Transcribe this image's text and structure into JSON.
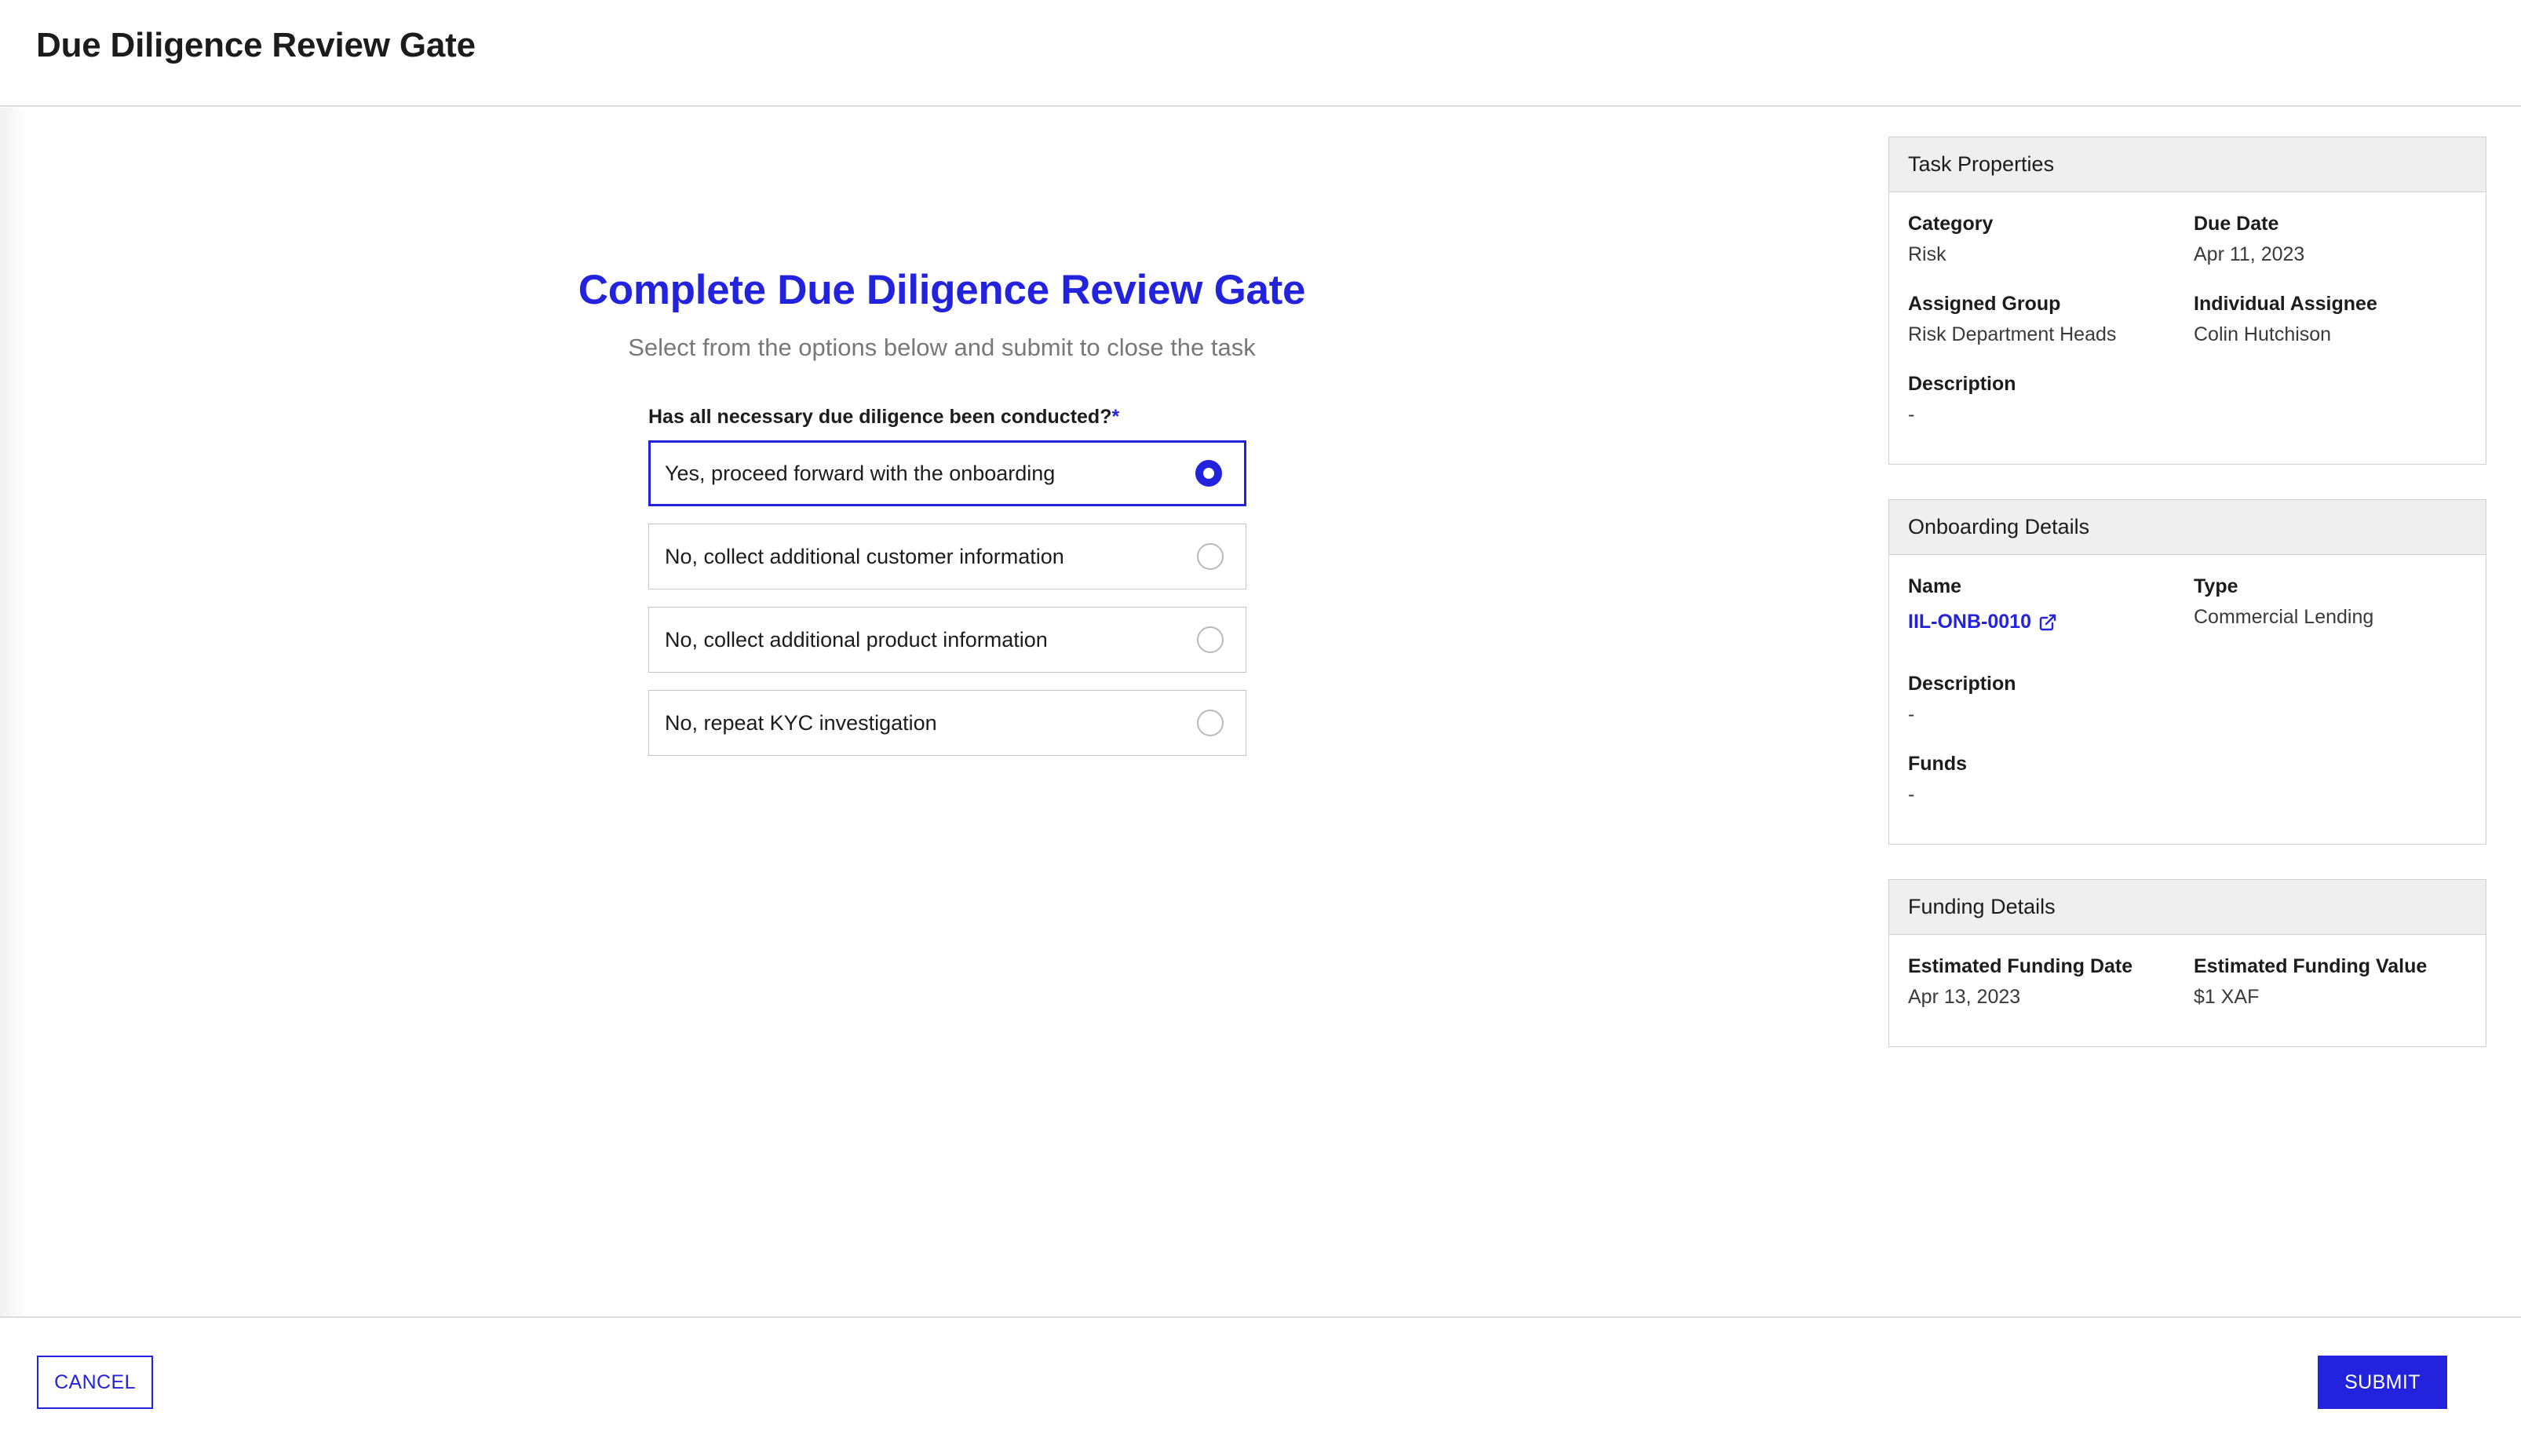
{
  "header": {
    "title": "Due Diligence Review Gate"
  },
  "form": {
    "title": "Complete Due Diligence Review Gate",
    "subtitle": "Select from the options below and submit to close the task",
    "question": {
      "label": "Has all necessary due diligence been conducted?",
      "required_marker": "*",
      "options": [
        {
          "label": "Yes, proceed forward with the onboarding",
          "selected": true
        },
        {
          "label": "No, collect additional customer information",
          "selected": false
        },
        {
          "label": "No, collect additional product information",
          "selected": false
        },
        {
          "label": "No, repeat KYC investigation",
          "selected": false
        }
      ]
    }
  },
  "panels": {
    "task_properties": {
      "title": "Task Properties",
      "category_key": "Category",
      "category_value": "Risk",
      "due_date_key": "Due Date",
      "due_date_value": "Apr 11, 2023",
      "assigned_group_key": "Assigned Group",
      "assigned_group_value": "Risk Department Heads",
      "individual_assignee_key": "Individual Assignee",
      "individual_assignee_value": "Colin Hutchison",
      "description_key": "Description",
      "description_value": "-"
    },
    "onboarding_details": {
      "title": "Onboarding Details",
      "name_key": "Name",
      "name_value": "IIL-ONB-0010",
      "type_key": "Type",
      "type_value": "Commercial Lending",
      "description_key": "Description",
      "description_value": "-",
      "funds_key": "Funds",
      "funds_value": "-"
    },
    "funding_details": {
      "title": "Funding Details",
      "est_funding_date_key": "Estimated Funding Date",
      "est_funding_date_value": "Apr 13, 2023",
      "est_funding_value_key": "Estimated Funding Value",
      "est_funding_value_value": "$1 XAF"
    }
  },
  "footer": {
    "cancel_label": "CANCEL",
    "submit_label": "SUBMIT"
  },
  "colors": {
    "accent": "#2323dd",
    "panel_header_bg": "#efefef",
    "border": "#cfcfcf",
    "muted_text": "#78787c"
  },
  "icons": {
    "external_link": "external-link-icon"
  }
}
